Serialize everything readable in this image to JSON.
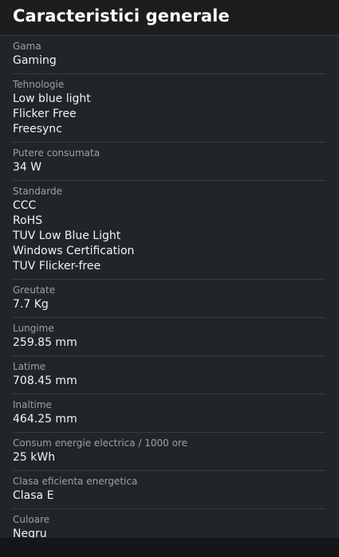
{
  "title": "Caracteristici generale",
  "specs": [
    {
      "label": "Gama",
      "values": [
        "Gaming"
      ]
    },
    {
      "label": "Tehnologie",
      "values": [
        "Low blue light",
        "Flicker Free",
        "Freesync"
      ]
    },
    {
      "label": "Putere consumata",
      "values": [
        "34 W"
      ]
    },
    {
      "label": "Standarde",
      "values": [
        "CCC",
        "RoHS",
        "TUV Low Blue Light",
        "Windows Certification",
        "TUV Flicker-free"
      ]
    },
    {
      "label": "Greutate",
      "values": [
        "7.7 Kg"
      ]
    },
    {
      "label": "Lungime",
      "values": [
        "259.85 mm"
      ]
    },
    {
      "label": "Latime",
      "values": [
        "708.45 mm"
      ]
    },
    {
      "label": "Inaltime",
      "values": [
        "464.25 mm"
      ]
    },
    {
      "label": "Consum energie electrica / 1000 ore",
      "values": [
        "25 kWh"
      ]
    },
    {
      "label": "Clasa eficienta energetica",
      "values": [
        "Clasa E"
      ]
    },
    {
      "label": "Culoare",
      "values": [
        "Negru"
      ]
    }
  ]
}
